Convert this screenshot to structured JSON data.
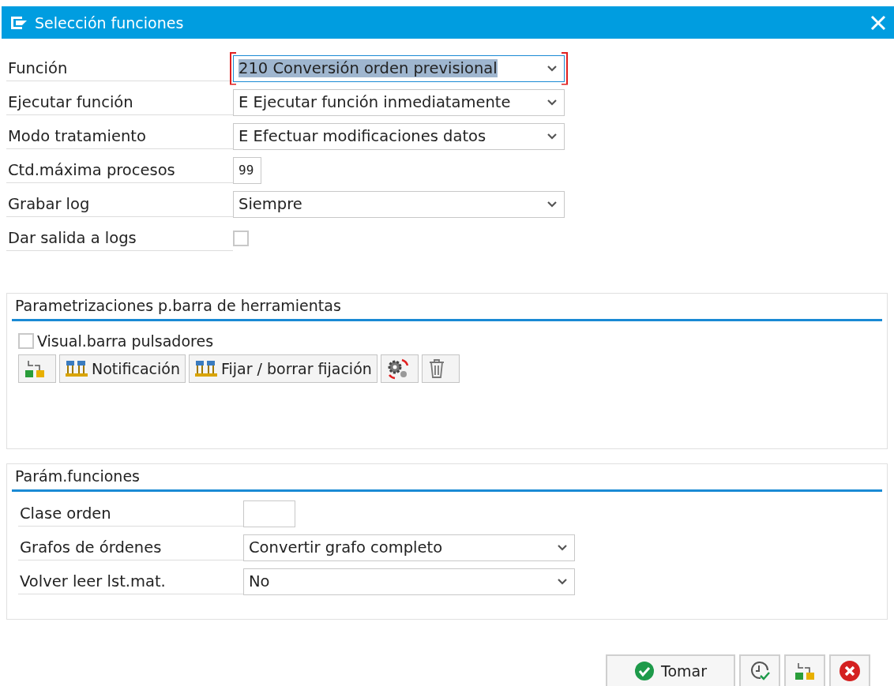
{
  "window": {
    "title": "Selección funciones"
  },
  "fields": [
    {
      "label": "Función",
      "kind": "select",
      "value": "210 Conversión orden previsional",
      "focused": true
    },
    {
      "label": "Ejecutar función",
      "kind": "select",
      "value": "E Ejecutar función inmediatamente",
      "focused": false
    },
    {
      "label": "Modo tratamiento",
      "kind": "select",
      "value": "E Efectuar modificaciones datos",
      "focused": false
    },
    {
      "label": "Ctd.máxima procesos",
      "kind": "input",
      "value": "99"
    },
    {
      "label": "Grabar log",
      "kind": "select",
      "value": "Siempre",
      "focused": false
    },
    {
      "label": "Dar salida a logs",
      "kind": "checkbox",
      "checked": false
    }
  ],
  "toolbar_section": {
    "title": "Parametrizaciones p.barra de herramientas",
    "checkbox": {
      "label": "Visual.barra pulsadores",
      "checked": false
    },
    "buttons": [
      {
        "kind": "flow"
      },
      {
        "kind": "text",
        "label": "Notificación"
      },
      {
        "kind": "text",
        "label": "Fijar / borrar fijación"
      },
      {
        "kind": "gears"
      },
      {
        "kind": "trash"
      }
    ]
  },
  "params_section": {
    "title": "Parám.funciones",
    "fields": [
      {
        "label": "Clase orden",
        "kind": "input"
      },
      {
        "label": "Grafos de órdenes",
        "kind": "select",
        "value": "Convertir grafo completo"
      },
      {
        "label": "Volver leer lst.mat.",
        "kind": "select",
        "value": "No"
      }
    ]
  },
  "footer_buttons": [
    {
      "kind": "confirm",
      "label": "Tomar"
    },
    {
      "kind": "clock"
    },
    {
      "kind": "flow"
    },
    {
      "kind": "cancel"
    }
  ]
}
